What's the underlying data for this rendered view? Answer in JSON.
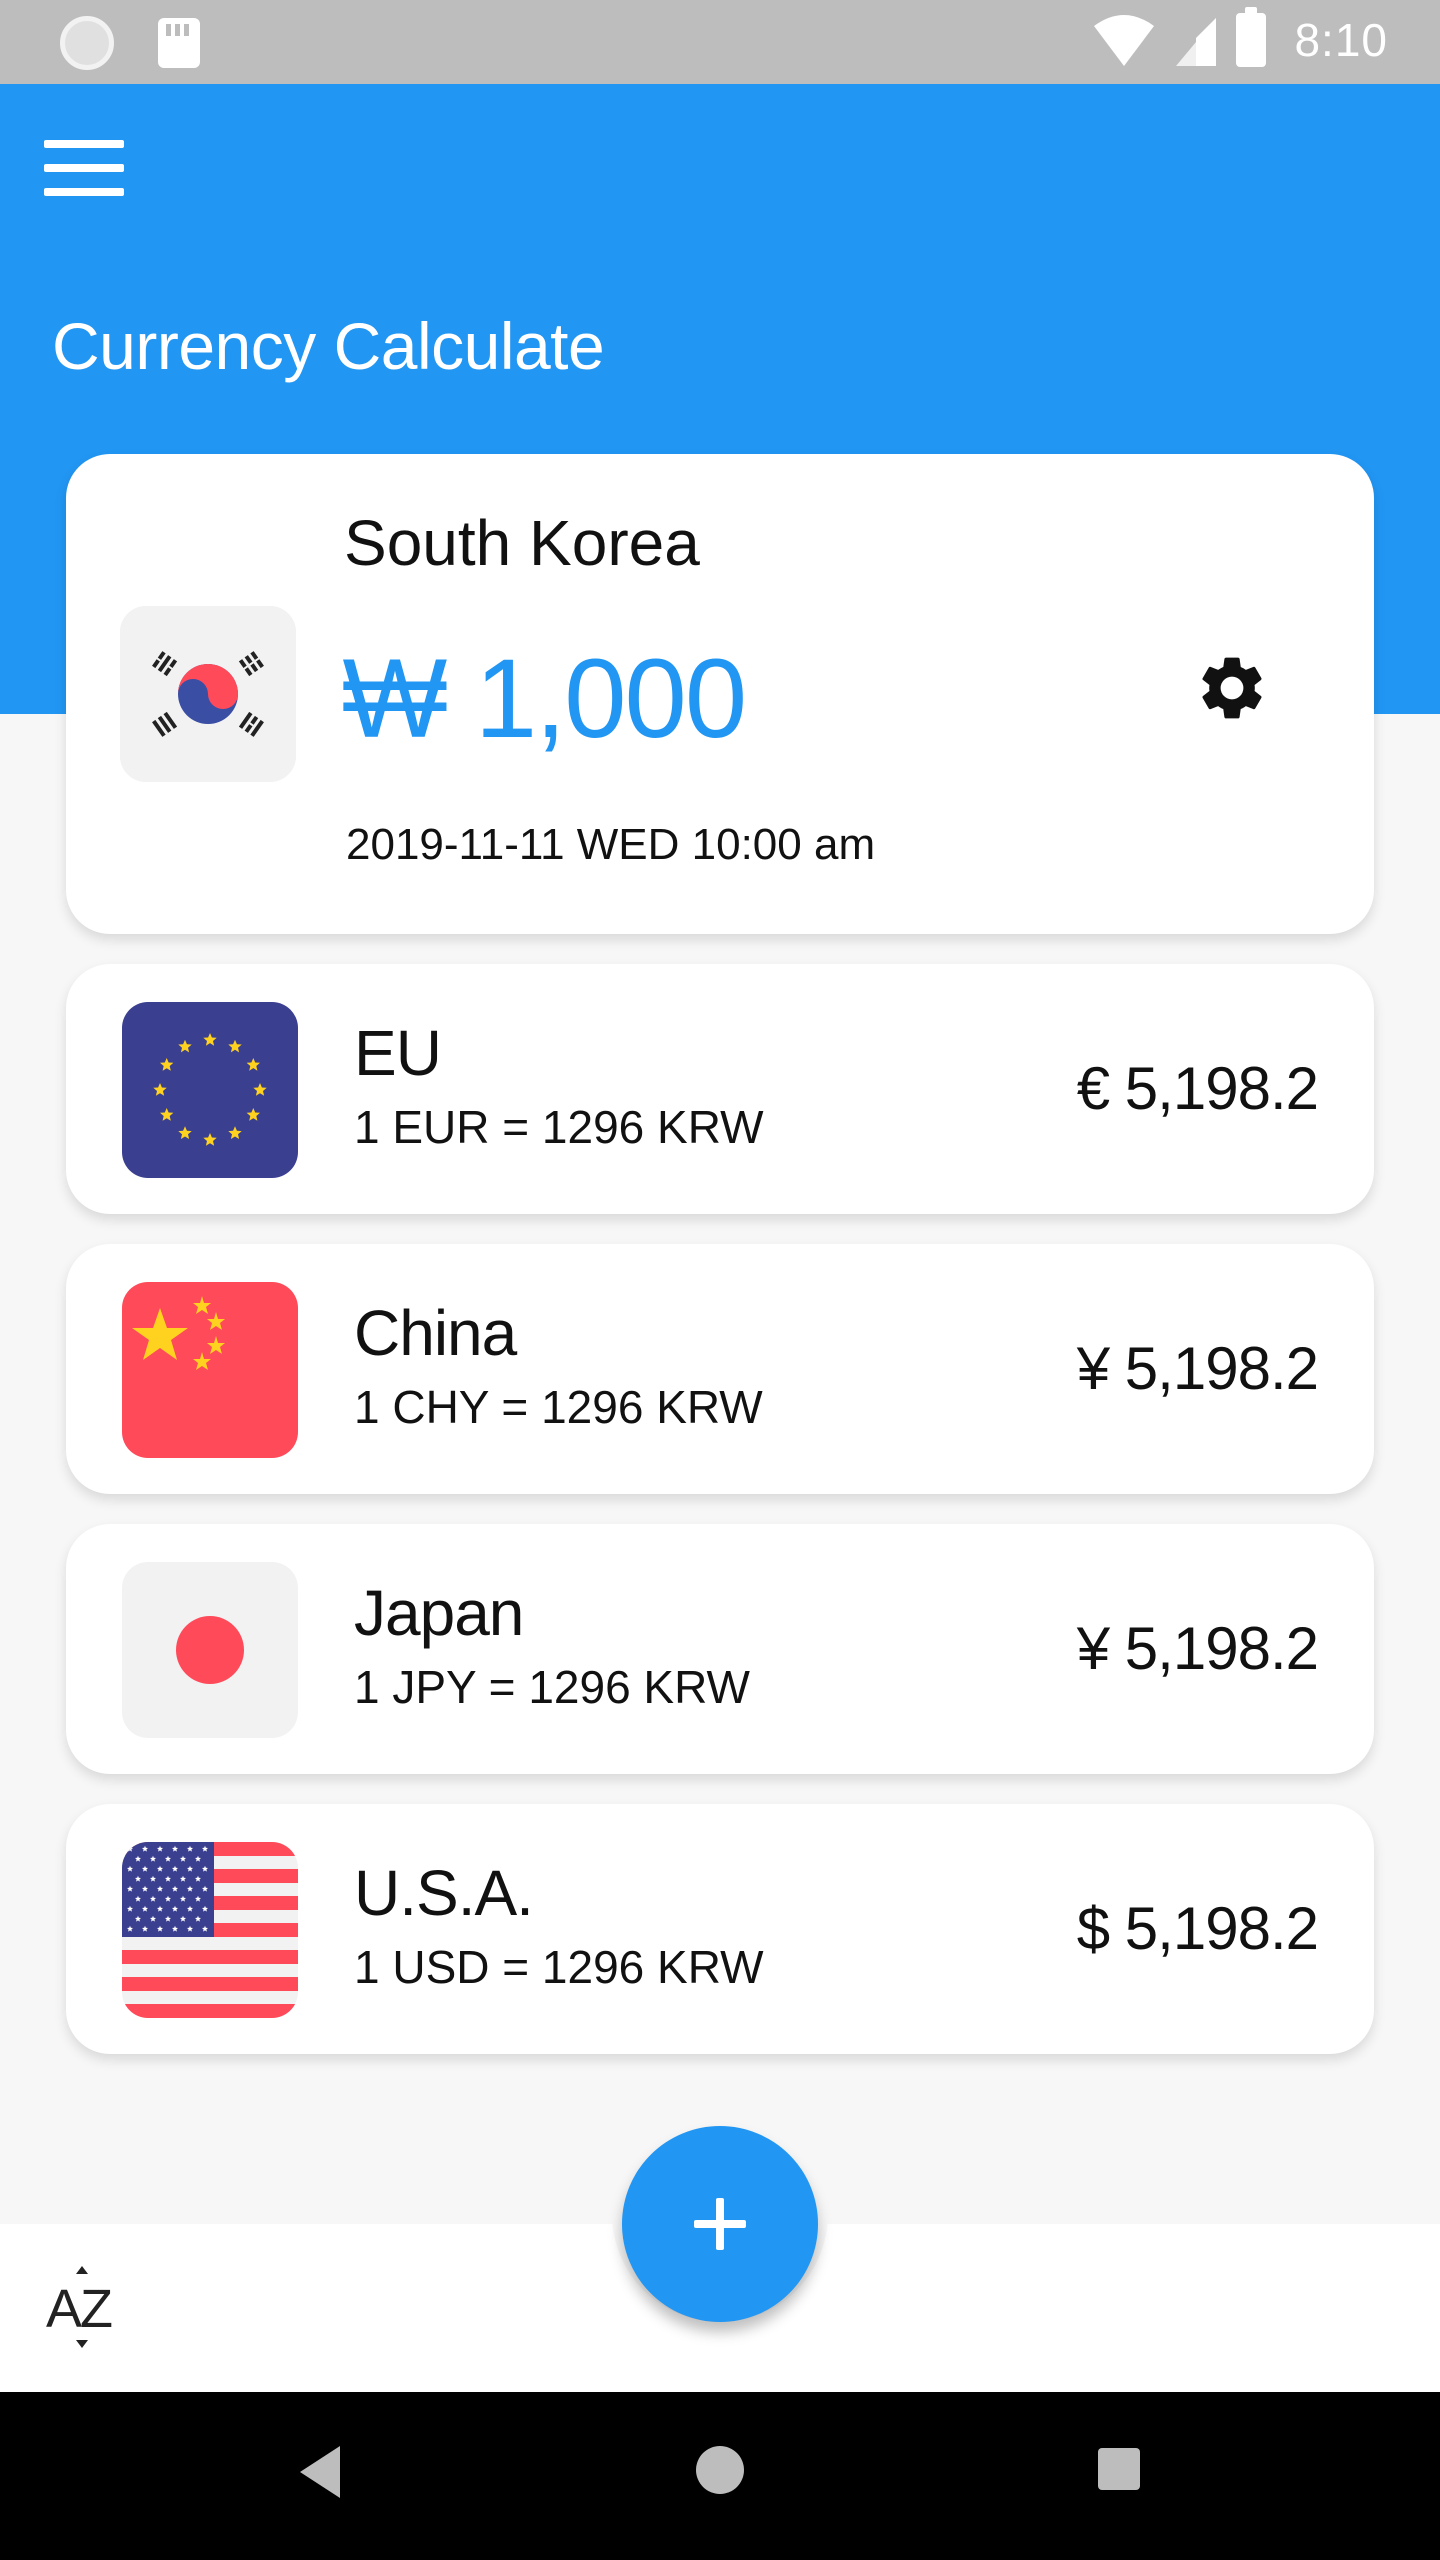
{
  "status_bar": {
    "time": "8:10"
  },
  "header": {
    "title": "Currency Calculate",
    "menu_icon": "hamburger-menu-icon",
    "color": "#2196f3"
  },
  "base": {
    "country": "South Korea",
    "amount": "₩ 1,000",
    "datetime": "2019-11-11 WED 10:00 am",
    "settings_icon": "gear-icon"
  },
  "currencies": [
    {
      "name": "EU",
      "rate": "1 EUR = 1296 KRW",
      "value": "€ 5,198.2",
      "flag": "eu-flag-icon"
    },
    {
      "name": "China",
      "rate": "1 CHY = 1296 KRW",
      "value": "¥ 5,198.2",
      "flag": "china-flag-icon"
    },
    {
      "name": "Japan",
      "rate": "1 JPY = 1296 KRW",
      "value": "¥ 5,198.2",
      "flag": "japan-flag-icon"
    },
    {
      "name": "U.S.A.",
      "rate": "1 USD = 1296 KRW",
      "value": "$ 5,198.2",
      "flag": "usa-flag-icon"
    }
  ],
  "bottom_bar": {
    "sort_label": "AZ",
    "add_icon": "plus-icon"
  }
}
